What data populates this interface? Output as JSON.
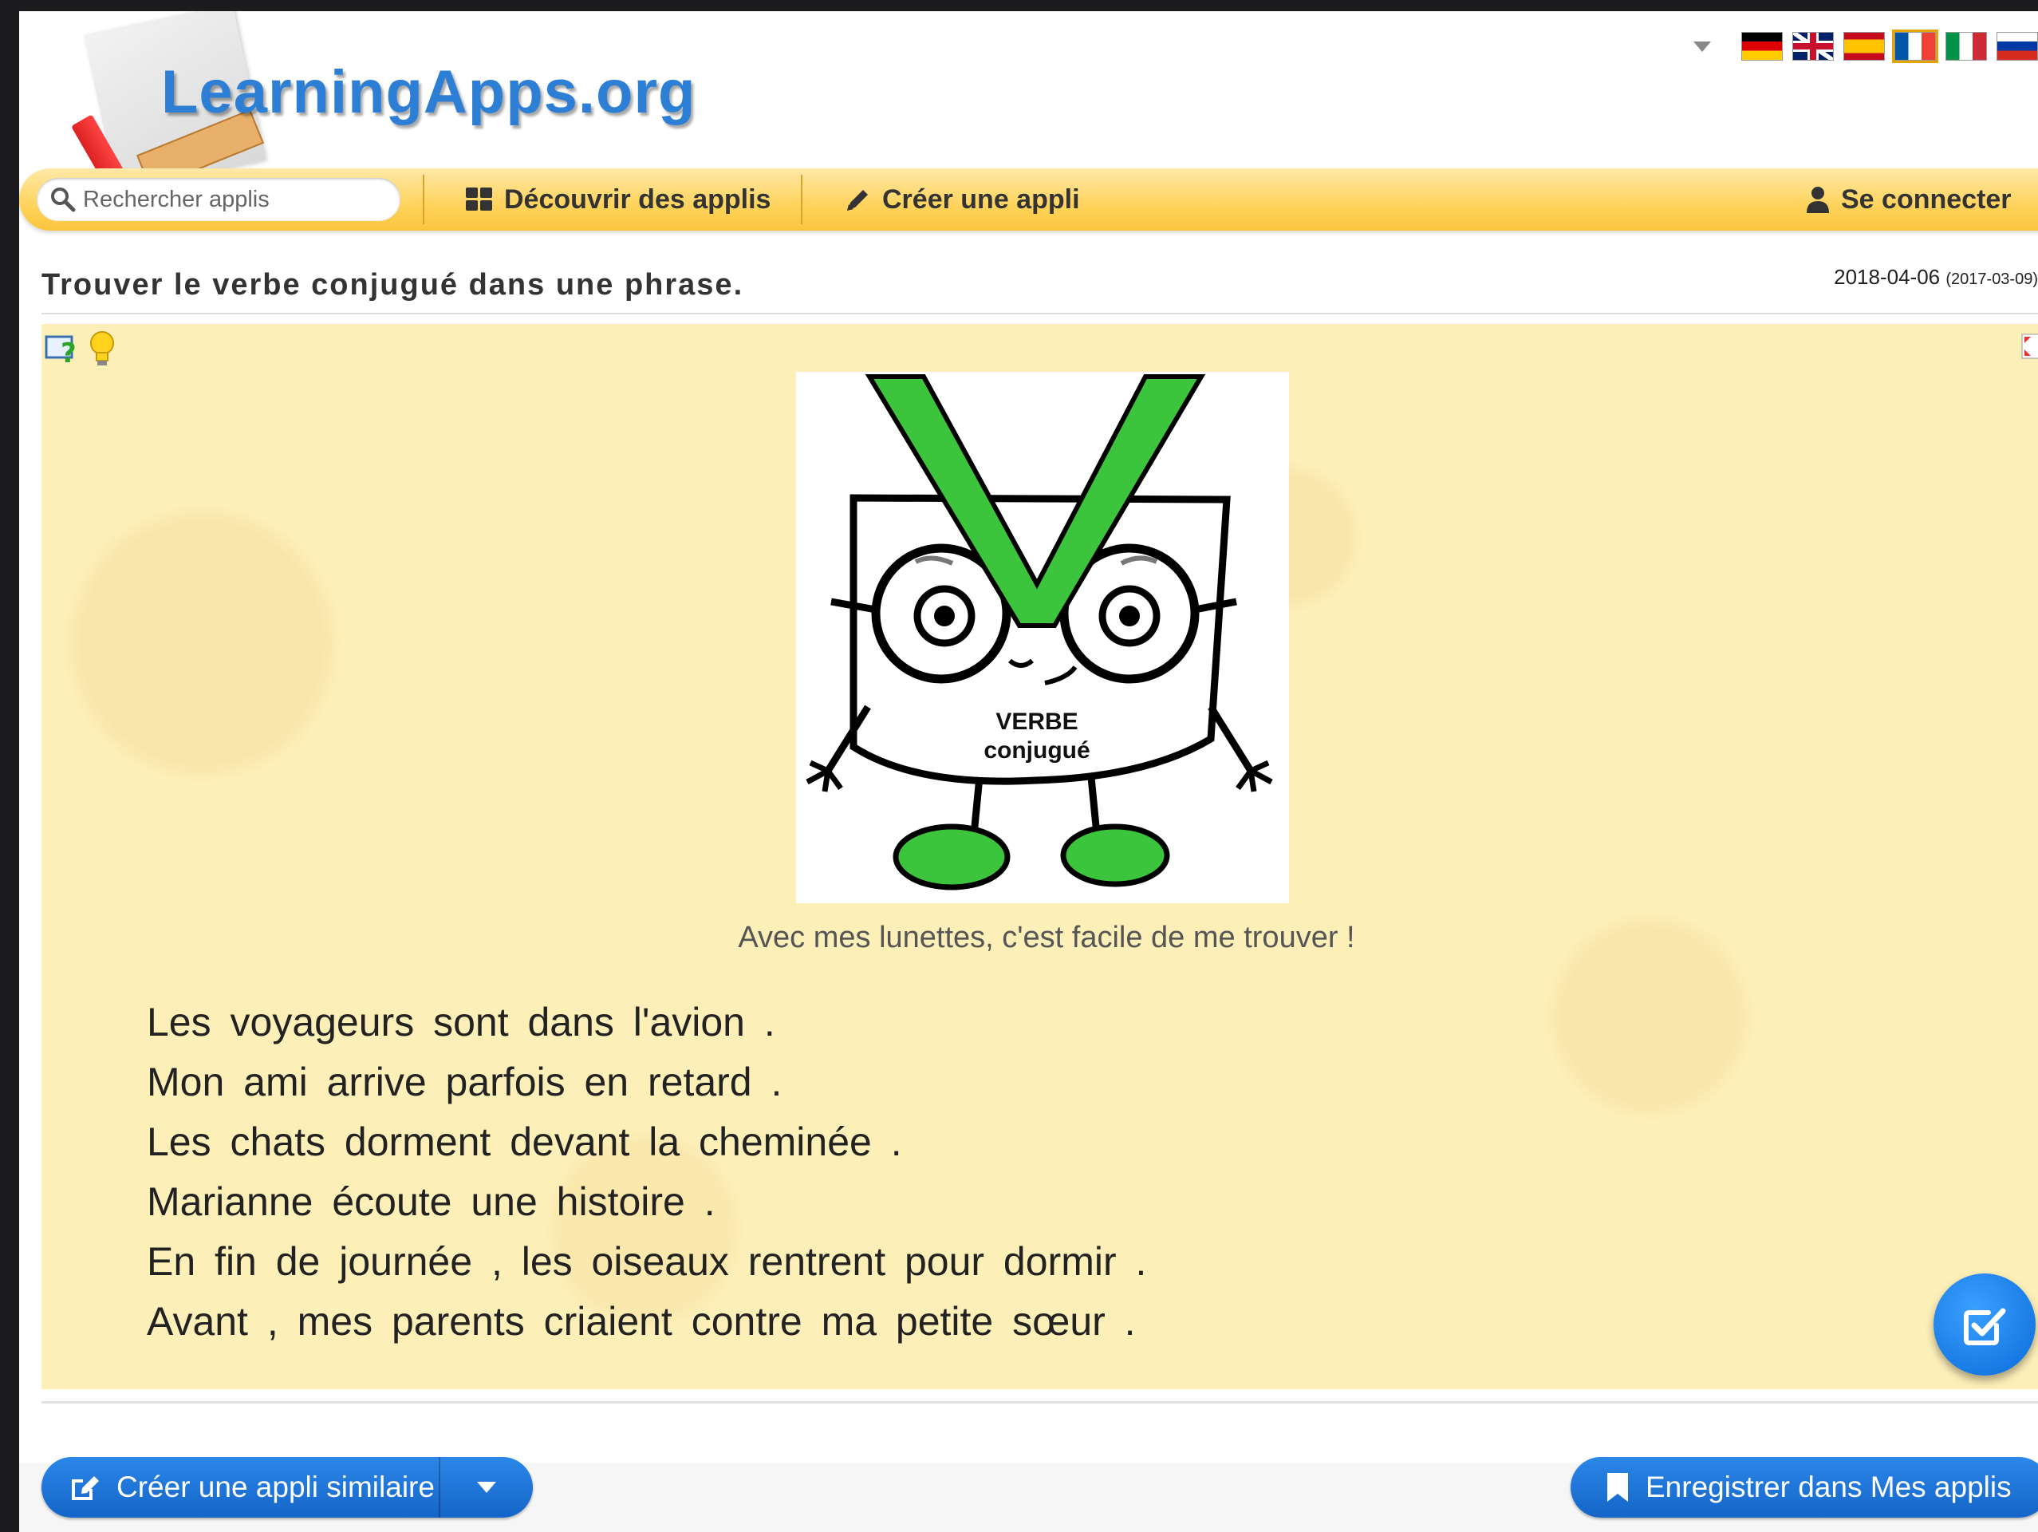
{
  "logo": {
    "text": "LearningApps.org"
  },
  "languages": [
    {
      "code": "de",
      "name": "Deutsch"
    },
    {
      "code": "en",
      "name": "English"
    },
    {
      "code": "es",
      "name": "Español"
    },
    {
      "code": "fr",
      "name": "Français",
      "active": true
    },
    {
      "code": "it",
      "name": "Italiano"
    },
    {
      "code": "ru",
      "name": "Русский"
    }
  ],
  "nav": {
    "search_placeholder": "Rechercher applis",
    "discover_label": "Découvrir des applis",
    "create_label": "Créer une appli",
    "login_label": "Se connecter"
  },
  "app": {
    "title": "Trouver le verbe conjugué dans une phrase.",
    "date_modified": "2018-04-06",
    "date_created": "(2017-03-09)",
    "mascot_text_line1": "VERBE",
    "mascot_text_line2": "conjugué",
    "caption": "Avec mes lunettes, c'est facile de me trouver !",
    "sentences": [
      "Les voyageurs sont dans l'avion .",
      "Mon ami arrive parfois en retard .",
      "Les chats dorment devant la cheminée .",
      "Marianne écoute une histoire .",
      "En fin de journée , les oiseaux rentrent pour dormir .",
      "Avant , mes parents criaient contre ma petite sœur ."
    ]
  },
  "footer": {
    "create_similar_label": "Créer une appli similaire",
    "save_label": "Enregistrer dans Mes applis"
  },
  "colors": {
    "nav_yellow": "#ffd35c",
    "app_background": "#fdefb8",
    "button_blue": "#1e78e0",
    "mascot_green": "#3cc43c"
  }
}
